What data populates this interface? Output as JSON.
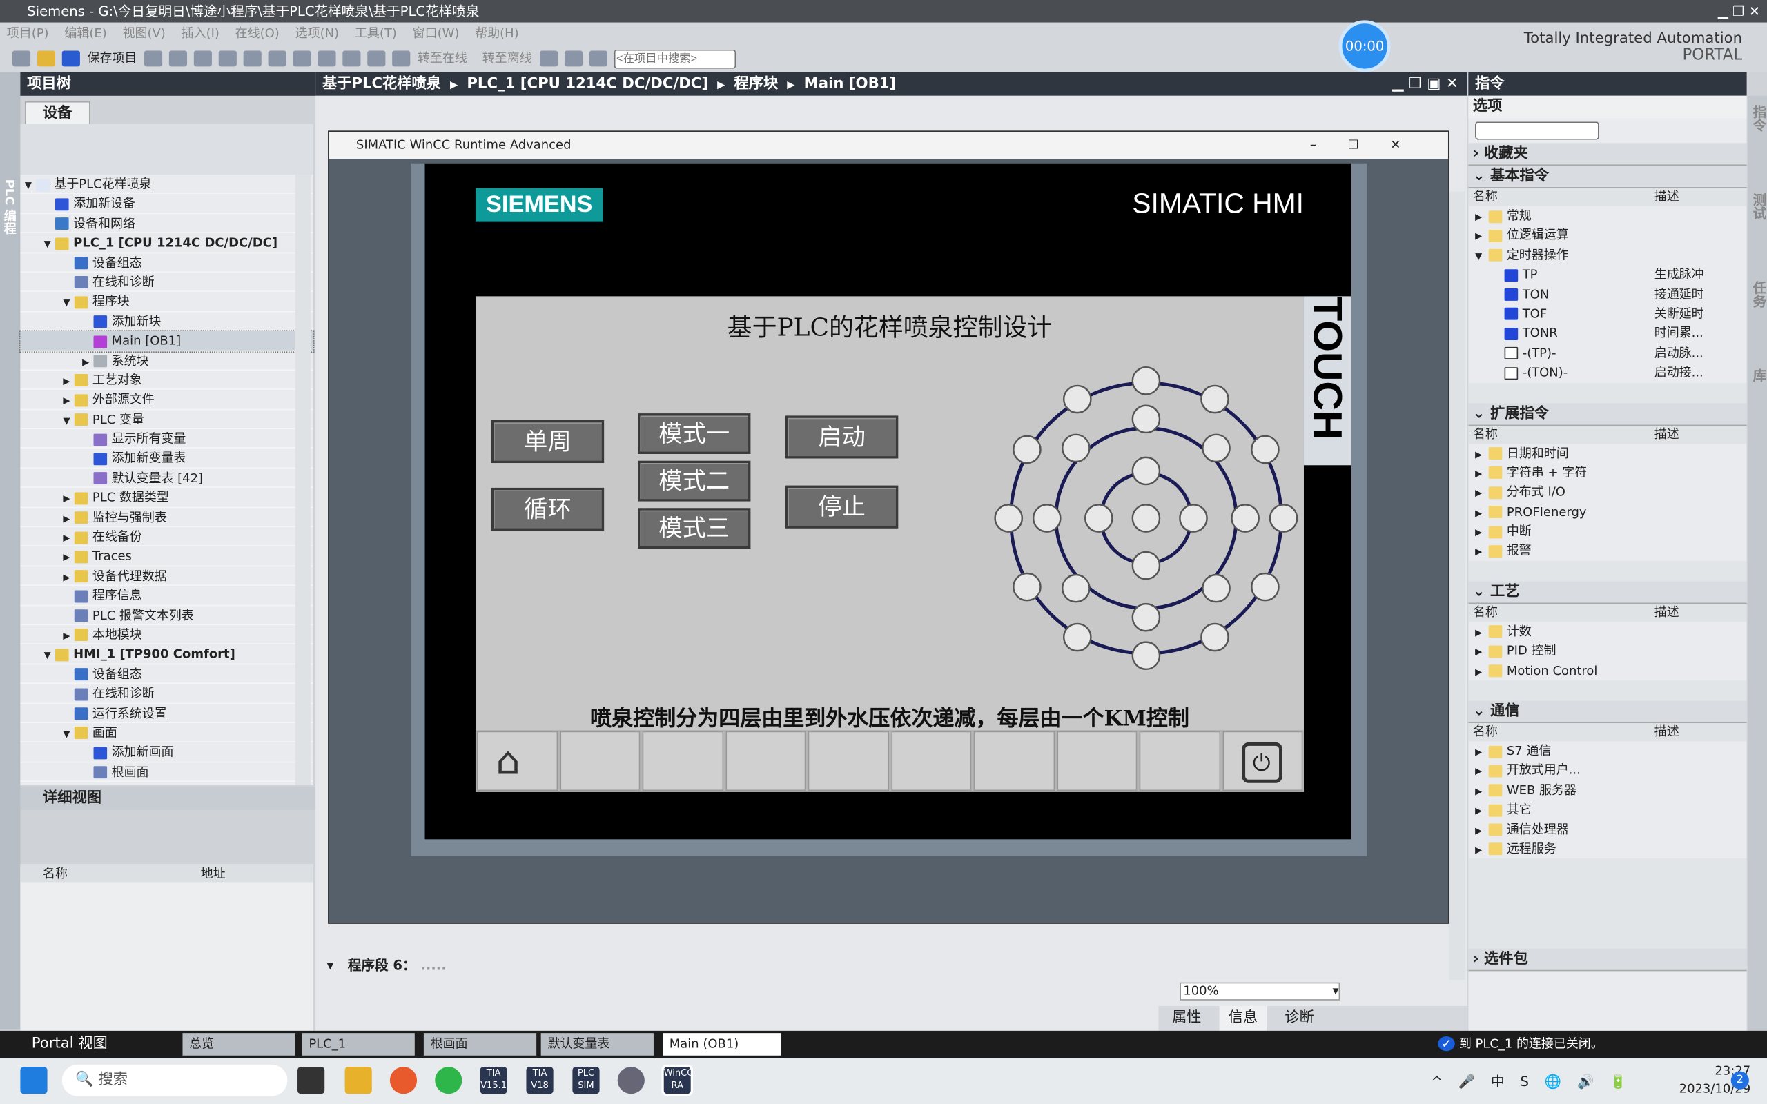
{
  "window": {
    "title": "Siemens  -  G:\\今日复明日\\博途小程序\\基于PLC花样喷泉\\基于PLC花样喷泉",
    "brand_line1": "Totally Integrated Automation",
    "brand_line2": "PORTAL",
    "timer": "00:00"
  },
  "menu": [
    "项目(P)",
    "编辑(E)",
    "视图(V)",
    "插入(I)",
    "在线(O)",
    "选项(N)",
    "工具(T)",
    "窗口(W)",
    "帮助(H)"
  ],
  "toolbar": {
    "save": "保存项目",
    "go_online": "转至在线",
    "go_offline": "转至离线",
    "search_placeholder": "<在项目中搜索>"
  },
  "project_tree": {
    "title": "项目树",
    "tab": "设备",
    "side_tab": "PLC 编程",
    "items": [
      {
        "label": "基于PLC花样喷泉",
        "level": 0,
        "exp": "open",
        "icon": "#dfe6f5"
      },
      {
        "label": "添加新设备",
        "level": 1,
        "exp": "",
        "icon": "#2c55d8"
      },
      {
        "label": "设备和网络",
        "level": 1,
        "exp": "",
        "icon": "#3a78c8"
      },
      {
        "label": "PLC_1 [CPU 1214C DC/DC/DC]",
        "level": 1,
        "exp": "open",
        "icon": "#e8c64c",
        "bold": true
      },
      {
        "label": "设备组态",
        "level": 2,
        "exp": "",
        "icon": "#3a6fc8"
      },
      {
        "label": "在线和诊断",
        "level": 2,
        "exp": "",
        "icon": "#6b7fb8"
      },
      {
        "label": "程序块",
        "level": 2,
        "exp": "open",
        "icon": "#e8c64c"
      },
      {
        "label": "添加新块",
        "level": 3,
        "exp": "",
        "icon": "#2c55d8"
      },
      {
        "label": "Main [OB1]",
        "level": 3,
        "exp": "",
        "icon": "#b33fd6",
        "selected": true
      },
      {
        "label": "系统块",
        "level": 3,
        "exp": "closed",
        "icon": "#aab0b8"
      },
      {
        "label": "工艺对象",
        "level": 2,
        "exp": "closed",
        "icon": "#e8c64c"
      },
      {
        "label": "外部源文件",
        "level": 2,
        "exp": "closed",
        "icon": "#e8c64c"
      },
      {
        "label": "PLC 变量",
        "level": 2,
        "exp": "open",
        "icon": "#e8c64c"
      },
      {
        "label": "显示所有变量",
        "level": 3,
        "exp": "",
        "icon": "#8a6fc8"
      },
      {
        "label": "添加新变量表",
        "level": 3,
        "exp": "",
        "icon": "#2c55d8"
      },
      {
        "label": "默认变量表 [42]",
        "level": 3,
        "exp": "",
        "icon": "#8a6fc8"
      },
      {
        "label": "PLC 数据类型",
        "level": 2,
        "exp": "closed",
        "icon": "#e8c64c"
      },
      {
        "label": "监控与强制表",
        "level": 2,
        "exp": "closed",
        "icon": "#e8c64c"
      },
      {
        "label": "在线备份",
        "level": 2,
        "exp": "closed",
        "icon": "#e8c64c"
      },
      {
        "label": "Traces",
        "level": 2,
        "exp": "closed",
        "icon": "#e8c64c"
      },
      {
        "label": "设备代理数据",
        "level": 2,
        "exp": "closed",
        "icon": "#e8c64c"
      },
      {
        "label": "程序信息",
        "level": 2,
        "exp": "",
        "icon": "#6b7fb8"
      },
      {
        "label": "PLC 报警文本列表",
        "level": 2,
        "exp": "",
        "icon": "#6b7fb8"
      },
      {
        "label": "本地模块",
        "level": 2,
        "exp": "closed",
        "icon": "#e8c64c"
      },
      {
        "label": "HMI_1 [TP900 Comfort]",
        "level": 1,
        "exp": "open",
        "icon": "#e8c64c",
        "bold": true
      },
      {
        "label": "设备组态",
        "level": 2,
        "exp": "",
        "icon": "#3a6fc8"
      },
      {
        "label": "在线和诊断",
        "level": 2,
        "exp": "",
        "icon": "#6b7fb8"
      },
      {
        "label": "运行系统设置",
        "level": 2,
        "exp": "",
        "icon": "#3a6fc8"
      },
      {
        "label": "画面",
        "level": 2,
        "exp": "open",
        "icon": "#e8c64c"
      },
      {
        "label": "添加新画面",
        "level": 3,
        "exp": "",
        "icon": "#2c55d8"
      },
      {
        "label": "根画面",
        "level": 3,
        "exp": "",
        "icon": "#6b7fb8"
      }
    ]
  },
  "detail_view": {
    "title": "详细视图",
    "col_name": "名称",
    "col_address": "地址"
  },
  "breadcrumb": [
    "基于PLC花样喷泉",
    "PLC_1 [CPU 1214C DC/DC/DC]",
    "程序块",
    "Main [OB1]"
  ],
  "editor": {
    "segment": "程序段 6：",
    "segment_comment": ".....",
    "zoom": "100%"
  },
  "wincc": {
    "title": "SIMATIC WinCC Runtime Advanced",
    "logo": "SIEMENS",
    "hmi_brand": "SIMATIC HMI",
    "touch": "TOUCH",
    "screen_title": "基于PLC的花样喷泉控制设计",
    "buttons": {
      "single": "单周",
      "loop": "循环",
      "mode1": "模式一",
      "mode2": "模式二",
      "mode3": "模式三",
      "start": "启动",
      "stop": "停止"
    },
    "caption": "喷泉控制分为四层由里到外水压依次递减，每层由一个KM控制"
  },
  "instructions": {
    "title": "指令",
    "options": "选项",
    "favorites": "收藏夹",
    "basic": {
      "title": "基本指令",
      "col_name": "名称",
      "col_desc": "描述",
      "items": [
        {
          "name": "常规",
          "desc": "",
          "kind": "folder"
        },
        {
          "name": "位逻辑运算",
          "desc": "",
          "kind": "folder"
        },
        {
          "name": "定时器操作",
          "desc": "",
          "kind": "folder-open"
        },
        {
          "name": "TP",
          "desc": "生成脉冲",
          "kind": "block"
        },
        {
          "name": "TON",
          "desc": "接通延时",
          "kind": "block"
        },
        {
          "name": "TOF",
          "desc": "关断延时",
          "kind": "block"
        },
        {
          "name": "TONR",
          "desc": "时间累...",
          "kind": "block"
        },
        {
          "name": "-(TP)-",
          "desc": "启动脉...",
          "kind": "coil"
        },
        {
          "name": "-(TON)-",
          "desc": "启动接...",
          "kind": "coil"
        }
      ]
    },
    "extended": {
      "title": "扩展指令",
      "col_name": "名称",
      "col_desc": "描述",
      "items": [
        {
          "name": "日期和时间"
        },
        {
          "name": "字符串 + 字符"
        },
        {
          "name": "分布式 I/O"
        },
        {
          "name": "PROFIenergy"
        },
        {
          "name": "中断"
        },
        {
          "name": "报警"
        }
      ]
    },
    "technology": {
      "title": "工艺",
      "col_name": "名称",
      "col_desc": "描述",
      "items": [
        {
          "name": "计数"
        },
        {
          "name": "PID 控制"
        },
        {
          "name": "Motion Control"
        }
      ]
    },
    "communication": {
      "title": "通信",
      "col_name": "名称",
      "col_desc": "描述",
      "items": [
        {
          "name": "S7 通信"
        },
        {
          "name": "开放式用户..."
        },
        {
          "name": "WEB 服务器"
        },
        {
          "name": "其它"
        },
        {
          "name": "通信处理器"
        },
        {
          "name": "远程服务"
        }
      ]
    },
    "packages": "选件包",
    "side_tabs": [
      "指令",
      "测试",
      "任务",
      "库"
    ]
  },
  "inspector_tabs": [
    "属性",
    "信息",
    "诊断"
  ],
  "status": {
    "portal_view": "Portal 视图",
    "tabs": [
      "总览",
      "PLC_1",
      "根画面",
      "默认变量表",
      "Main (OB1)"
    ],
    "message": "到 PLC_1 的连接已关闭。"
  },
  "taskbar": {
    "search": "搜索",
    "time": "23:27",
    "date": "2023/10/29",
    "notif": "2",
    "apps": [
      "TIA V15.1",
      "TIA V18",
      "PLC SIM",
      "WinCC RA"
    ]
  }
}
